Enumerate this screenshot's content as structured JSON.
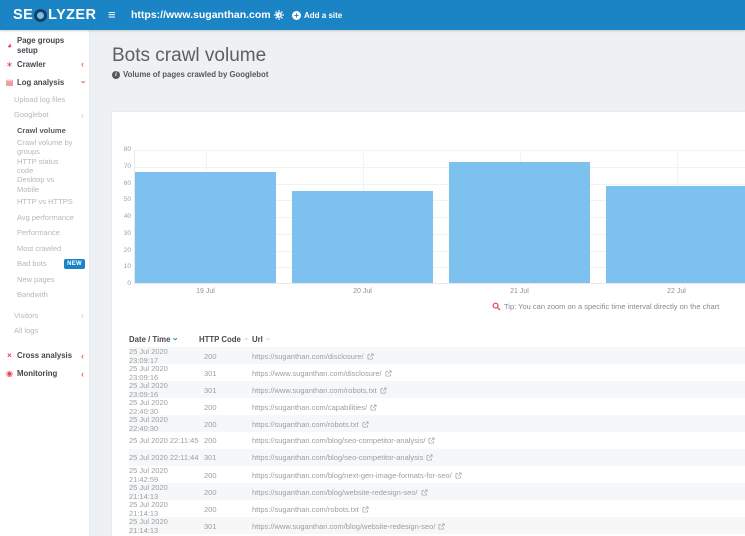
{
  "header": {
    "logo_pre": "SE",
    "logo_post": "LYZER",
    "site_url": "https://www.suganthan.com",
    "add_site_label": "Add a site"
  },
  "sidebar": {
    "items": [
      {
        "label": "Page groups setup",
        "level": 0,
        "icon": "page-groups-icon",
        "glyph": "◕"
      },
      {
        "label": "Crawler",
        "level": 0,
        "icon": "crawler-icon",
        "glyph": "∗",
        "chevron": "left",
        "chevron_color": "red"
      },
      {
        "label": "Log analysis",
        "level": 0,
        "icon": "log-analysis-icon",
        "glyph": "▤",
        "chevron": "down",
        "chevron_color": "red"
      },
      {
        "label": "Upload log files",
        "level": 1
      },
      {
        "label": "Googlebot",
        "level": 1,
        "chevron": "left",
        "chevron_color": "gray"
      },
      {
        "label": "Crawl volume",
        "level": 2,
        "active": true
      },
      {
        "label": "Crawl volume by groups",
        "level": 2
      },
      {
        "label": "HTTP status code",
        "level": 2
      },
      {
        "label": "Desktop vs Mobile",
        "level": 2
      },
      {
        "label": "HTTP vs HTTPS",
        "level": 2
      },
      {
        "label": "Avg performance",
        "level": 2
      },
      {
        "label": "Performance",
        "level": 2
      },
      {
        "label": "Most crawled",
        "level": 2
      },
      {
        "label": "Bad bots",
        "level": 2,
        "badge": "NEW"
      },
      {
        "label": "New pages",
        "level": 2
      },
      {
        "label": "Bandwith",
        "level": 2
      },
      {
        "label": "Visitors",
        "level": 1,
        "chevron": "left",
        "chevron_color": "gray",
        "gap": 5
      },
      {
        "label": "All logs",
        "level": 1
      },
      {
        "label": "Cross analysis",
        "level": 0,
        "icon": "cross-analysis-icon",
        "glyph": "×",
        "chevron": "left",
        "chevron_color": "red",
        "gap": 8
      },
      {
        "label": "Monitoring",
        "level": 0,
        "icon": "monitoring-icon",
        "glyph": "◉",
        "chevron": "left",
        "chevron_color": "red"
      }
    ]
  },
  "page": {
    "title": "Bots crawl volume",
    "subtitle": "Volume of pages crawled by Googlebot"
  },
  "chart_data": {
    "type": "bar",
    "title": "",
    "categories": [
      "19 Jul",
      "20 Jul",
      "21 Jul",
      "22 Jul"
    ],
    "values": [
      66,
      55,
      72,
      58
    ],
    "xlabel": "",
    "ylabel": "",
    "ylim": [
      0,
      80
    ],
    "yticks": [
      0,
      10,
      20,
      30,
      40,
      50,
      60,
      70,
      80
    ],
    "bar_color": "#7dc1ee",
    "grid": true,
    "legend": false
  },
  "chart_tip": "Tip: You can zoom on a specific time interval directly on the chart",
  "table": {
    "columns": [
      {
        "label": "Date / Time",
        "sort_active": true
      },
      {
        "label": "HTTP Code",
        "sort_active": false
      },
      {
        "label": "Url",
        "sort_active": false
      }
    ],
    "rows": [
      {
        "datetime": "25 Jul 2020 23:09:17",
        "code": "200",
        "url": "https://suganthan.com/disclosure/"
      },
      {
        "datetime": "25 Jul 2020 23:09:16",
        "code": "301",
        "url": "https://www.suganthan.com/disclosure/"
      },
      {
        "datetime": "25 Jul 2020 23:09:16",
        "code": "301",
        "url": "https://www.suganthan.com/robots.txt"
      },
      {
        "datetime": "25 Jul 2020 22:40:30",
        "code": "200",
        "url": "https://suganthan.com/capabilities/"
      },
      {
        "datetime": "25 Jul 2020 22:40:30",
        "code": "200",
        "url": "https://suganthan.com/robots.txt"
      },
      {
        "datetime": "25 Jul 2020 22:11:45",
        "code": "200",
        "url": "https://suganthan.com/blog/seo-competitor-analysis/"
      },
      {
        "datetime": "25 Jul 2020 22:11:44",
        "code": "301",
        "url": "https://suganthan.com/blog/seo-competitor-analysis"
      },
      {
        "datetime": "25 Jul 2020 21:42:59",
        "code": "200",
        "url": "https://suganthan.com/blog/next-gen-image-formats-for-seo/"
      },
      {
        "datetime": "25 Jul 2020 21:14:13",
        "code": "200",
        "url": "https://suganthan.com/blog/website-redesign-seo/"
      },
      {
        "datetime": "25 Jul 2020 21:14:13",
        "code": "200",
        "url": "https://suganthan.com/robots.txt"
      },
      {
        "datetime": "25 Jul 2020 21:14:13",
        "code": "301",
        "url": "https://www.suganthan.com/blog/website-redesign-seo/"
      }
    ]
  },
  "colors": {
    "topbar_blue": "#1b84c5",
    "bar_blue": "#7dc1ee",
    "accent_red": "#e5404f",
    "badge_blue": "#1a84c6",
    "row_stripe": "#f6f7f8"
  }
}
